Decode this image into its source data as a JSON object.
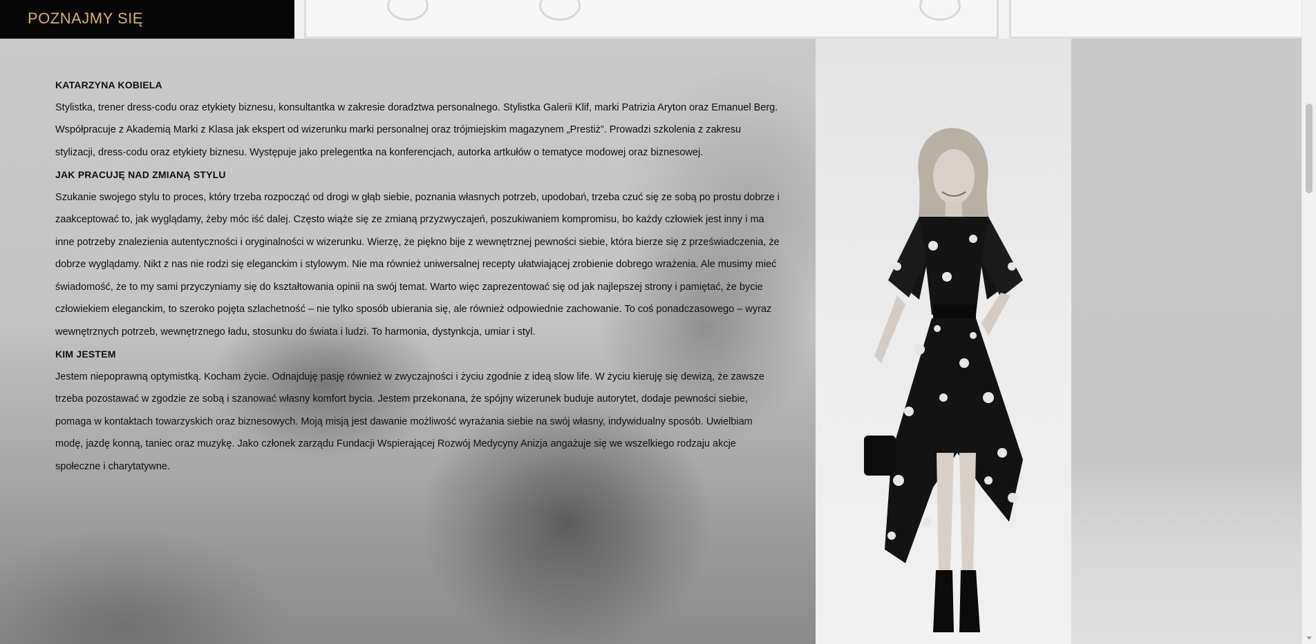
{
  "header": {
    "section_label": "POZNAJMY SIĘ",
    "accent_color": "#d9b25e"
  },
  "content": {
    "sections": [
      {
        "heading": "KATARZYNA KOBIELA",
        "text": "Stylistka, trener dress-codu oraz etykiety biznesu, konsultantka w zakresie doradztwa personalnego. Stylistka Galerii Klif, marki Patrizia Aryton oraz Emanuel Berg. Współpracuje z Akademią Marki z Klasa jak ekspert od wizerunku marki personalnej oraz trójmiejskim magazynem „Prestiż”. Prowadzi szkolenia z zakresu stylizacji, dress-codu oraz etykiety biznesu. Występuje jako prelegentka na konferencjach, autorka artkułów o tematyce modowej oraz biznesowej."
      },
      {
        "heading": "JAK PRACUJĘ NAD ZMIANĄ STYLU",
        "text": "Szukanie swojego stylu to proces, który trzeba rozpocząć od drogi w głąb siebie, poznania własnych potrzeb, upodobań, trzeba czuć się ze sobą po prostu dobrze i zaakceptować to, jak wyglądamy, żeby móc iść dalej. Często wiąże się ze zmianą przyzwyczajeń, poszukiwaniem kompromisu, bo każdy człowiek jest inny i ma inne potrzeby znalezienia autentyczności i oryginalności w wizerunku. Wierzę, że piękno bije z wewnętrznej pewności siebie, która bierze się z przeświadczenia, że dobrze wyglądamy. Nikt z nas nie rodzi się eleganckim i stylowym. Nie ma również uniwersalnej recepty ułatwiającej zrobienie dobrego wrażenia. Ale musimy mieć świadomość, że to my sami przyczyniamy się do kształtowania opinii na swój temat. Warto więc zaprezentować się od jak najlepszej strony i pamiętać, że bycie człowiekiem eleganckim, to szeroko pojęta szlachetność – nie tylko sposób ubierania się, ale również odpowiednie zachowanie. To coś ponadczasowego – wyraz wewnętrznych potrzeb, wewnętrznego ładu, stosunku do świata i ludzi. To harmonia, dystynkcja, umiar i styl."
      },
      {
        "heading": "KIM JESTEM",
        "text": "Jestem niepoprawną optymistką. Kocham życie. Odnajduję pasję również w zwyczajności i życiu zgodnie z ideą slow life. W życiu kieruję się dewizą, że zawsze trzeba pozostawać w zgodzie ze sobą i szanować własny komfort bycia. Jestem przekonana, że spójny wizerunek buduje autorytet, dodaje pewności siebie, pomaga w kontaktach towarzyskich oraz biznesowych. Moją misją jest dawanie możliwość wyrażania siebie na swój własny, indywidualny sposób. Uwielbiam modę, jazdę konną, taniec oraz muzykę. Jako członek zarządu Fundacji Wspierającej Rozwój Medycyny Anizja angażuje się we wszelkiego rodzaju akcje społeczne i charytatywne."
      }
    ]
  },
  "icons": {
    "portrait": "woman-portrait-photo",
    "scroll_arrow": "chevron-down-icon"
  }
}
